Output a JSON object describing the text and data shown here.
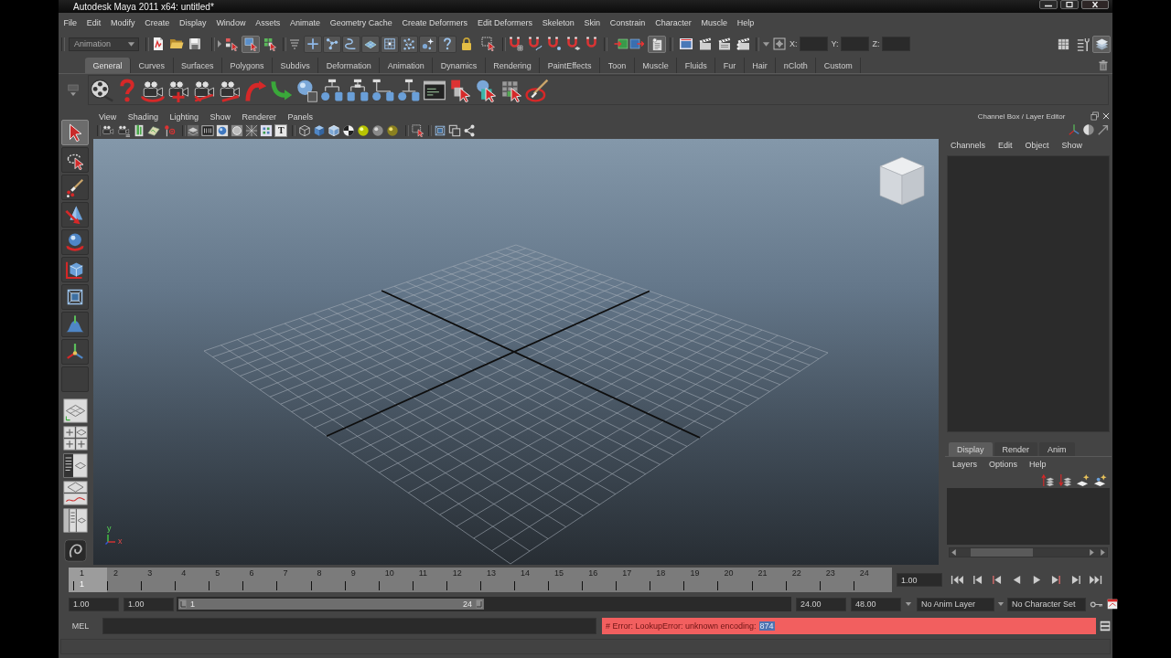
{
  "window": {
    "title": "Autodesk Maya 2011 x64: untitled*"
  },
  "menu_bar": [
    "File",
    "Edit",
    "Modify",
    "Create",
    "Display",
    "Window",
    "Assets",
    "Animate",
    "Geometry Cache",
    "Create Deformers",
    "Edit Deformers",
    "Skeleton",
    "Skin",
    "Constrain",
    "Character",
    "Muscle",
    "Help"
  ],
  "status_line": {
    "menu_set": "Animation",
    "selection_modes": [
      {
        "selected": false
      },
      {
        "selected": true
      },
      {
        "selected": false
      }
    ],
    "history_toggle": {
      "on": true
    },
    "coordinate_fields": [
      {
        "label": "X:"
      },
      {
        "label": "Y:"
      },
      {
        "label": "Z:"
      }
    ],
    "panel_toggles": [
      {
        "on": false
      },
      {
        "on": false
      },
      {
        "on": true
      }
    ]
  },
  "shelf": {
    "tabs": [
      {
        "label": "General",
        "selected": true
      },
      {
        "label": "Curves",
        "selected": false
      },
      {
        "label": "Surfaces",
        "selected": false
      },
      {
        "label": "Polygons",
        "selected": false
      },
      {
        "label": "Subdivs",
        "selected": false
      },
      {
        "label": "Deformation",
        "selected": false
      },
      {
        "label": "Animation",
        "selected": false
      },
      {
        "label": "Dynamics",
        "selected": false
      },
      {
        "label": "Rendering",
        "selected": false
      },
      {
        "label": "PaintEffects",
        "selected": false
      },
      {
        "label": "Toon",
        "selected": false
      },
      {
        "label": "Muscle",
        "selected": false
      },
      {
        "label": "Fluids",
        "selected": false
      },
      {
        "label": "Fur",
        "selected": false
      },
      {
        "label": "Hair",
        "selected": false
      },
      {
        "label": "nCloth",
        "selected": false
      },
      {
        "label": "Custom",
        "selected": false
      }
    ]
  },
  "toolbox": {
    "tools": [
      {
        "selected": true
      },
      {
        "selected": false
      },
      {
        "selected": false
      },
      {
        "selected": false
      },
      {
        "selected": false
      },
      {
        "selected": false
      },
      {
        "selected": false
      },
      {
        "selected": false
      },
      {
        "selected": false
      },
      {
        "selected": false
      }
    ]
  },
  "viewport": {
    "menus": [
      "View",
      "Shading",
      "Lighting",
      "Show",
      "Renderer",
      "Panels"
    ],
    "toolbar_glyph": "T",
    "axis_indicator": {
      "y_label": "y",
      "x_label": "x"
    }
  },
  "channel_box": {
    "title": "Channel Box / Layer Editor",
    "menus": [
      "Channels",
      "Edit",
      "Object",
      "Show"
    ]
  },
  "layer_editor": {
    "tabs": [
      {
        "label": "Display",
        "selected": true
      },
      {
        "label": "Render",
        "selected": false
      },
      {
        "label": "Anim",
        "selected": false
      }
    ],
    "menus": [
      "Layers",
      "Options",
      "Help"
    ]
  },
  "time_slider": {
    "frames": [
      {
        "label": "1",
        "current": true
      },
      {
        "label": "2",
        "current": false
      },
      {
        "label": "3",
        "current": false
      },
      {
        "label": "4",
        "current": false
      },
      {
        "label": "5",
        "current": false
      },
      {
        "label": "6",
        "current": false
      },
      {
        "label": "7",
        "current": false
      },
      {
        "label": "8",
        "current": false
      },
      {
        "label": "9",
        "current": false
      },
      {
        "label": "10",
        "current": false
      },
      {
        "label": "11",
        "current": false
      },
      {
        "label": "12",
        "current": false
      },
      {
        "label": "13",
        "current": false
      },
      {
        "label": "14",
        "current": false
      },
      {
        "label": "15",
        "current": false
      },
      {
        "label": "16",
        "current": false
      },
      {
        "label": "17",
        "current": false
      },
      {
        "label": "18",
        "current": false
      },
      {
        "label": "19",
        "current": false
      },
      {
        "label": "20",
        "current": false
      },
      {
        "label": "21",
        "current": false
      },
      {
        "label": "22",
        "current": false
      },
      {
        "label": "23",
        "current": false
      },
      {
        "label": "24",
        "current": false
      }
    ],
    "current_frame": "1",
    "current_time": "1.00"
  },
  "range_slider": {
    "start_time": "1.00",
    "playback_start": "1.00",
    "range_start": "1",
    "range_end": "24",
    "level": 0.5,
    "playback_end": "24.00",
    "end_time": "48.00",
    "anim_layer": "No Anim Layer",
    "character_set": "No Character Set"
  },
  "command_line": {
    "language": "MEL",
    "result": "# Error: LookupError: unknown encoding:",
    "selected_text": "874"
  }
}
